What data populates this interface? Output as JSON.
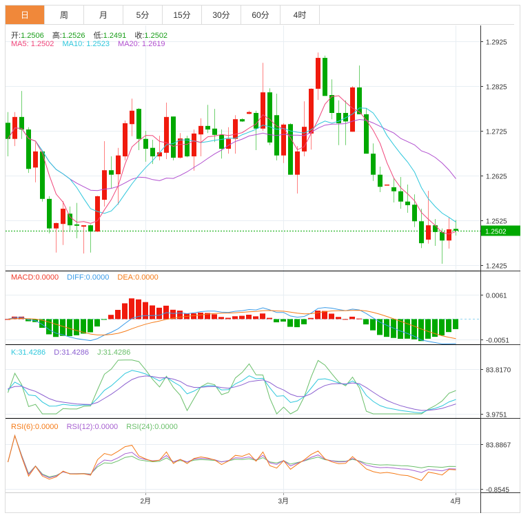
{
  "tabs": [
    "日",
    "周",
    "月",
    "5分",
    "15分",
    "30分",
    "60分",
    "4时"
  ],
  "active_tab": 0,
  "ohlc_legend": {
    "open_label": "开:",
    "open": "1.2506",
    "high_label": "高:",
    "high": "1.2526",
    "low_label": "低:",
    "low": "1.2491",
    "close_label": "收:",
    "close": "1.2502"
  },
  "ma_legend": {
    "ma5_label": "MA5:",
    "ma5": "1.2502",
    "ma10_label": "MA10:",
    "ma10": "1.2523",
    "ma20_label": "MA20:",
    "ma20": "1.2619"
  },
  "macd_legend": {
    "macd_label": "MACD:",
    "macd": "0.0000",
    "diff_label": "DIFF:",
    "diff": "0.0000",
    "dea_label": "DEA:",
    "dea": "0.0000"
  },
  "kdj_legend": {
    "k_label": "K:",
    "k": "31.4286",
    "d_label": "D:",
    "d": "31.4286",
    "j_label": "J:",
    "j": "31.4286"
  },
  "rsi_legend": {
    "rsi6_label": "RSI(6):",
    "rsi6": "0.0000",
    "rsi12_label": "RSI(12):",
    "rsi12": "0.0000",
    "rsi24_label": "RSI(24):",
    "rsi24": "0.0000"
  },
  "colors": {
    "accent": "#f0883a",
    "up": "#f01a0d",
    "down": "#00a800",
    "up_wick": "#ff7f7f",
    "down_wick": "#6fd06f",
    "ma5": "#f0457a",
    "ma10": "#2ec7dc",
    "ma20": "#b14fcf",
    "diff": "#3a9be8",
    "dea": "#f57a16",
    "k": "#2ec7dc",
    "d": "#8b5fd0",
    "j": "#6abf6a",
    "rsi6": "#f57a16",
    "rsi12": "#a65fd0",
    "rsi24": "#6abf6a"
  },
  "chart_data": {
    "type": "candlestick",
    "price_axis": {
      "ticks": [
        "1.2925",
        "1.2825",
        "1.2725",
        "1.2625",
        "1.2525",
        "1.2425"
      ],
      "range": [
        1.2425,
        1.2925
      ]
    },
    "last_price": "1.2502",
    "macd_axis": {
      "ticks": [
        "0.0061",
        "-0.0051"
      ],
      "range": [
        -0.0051,
        0.0061
      ]
    },
    "kdj_axis": {
      "ticks": [
        "83.8170",
        "3.9751"
      ],
      "range": [
        3.9751,
        83.817
      ]
    },
    "rsi_axis": {
      "ticks": [
        "83.8867",
        "-0.8545"
      ],
      "range": [
        -0.8545,
        83.8867
      ]
    },
    "x_labels": [
      {
        "index": 20,
        "label": "2月"
      },
      {
        "index": 40,
        "label": "3月"
      },
      {
        "index": 65,
        "label": "4月"
      }
    ],
    "ohlc": [
      [
        1.2743,
        1.2767,
        1.2668,
        1.2707
      ],
      [
        1.2707,
        1.2767,
        1.2691,
        1.2756
      ],
      [
        1.2756,
        1.2814,
        1.2707,
        1.2728
      ],
      [
        1.2728,
        1.2733,
        1.2631,
        1.264
      ],
      [
        1.2643,
        1.2699,
        1.261,
        1.2679
      ],
      [
        1.2679,
        1.2679,
        1.2567,
        1.2573
      ],
      [
        1.2573,
        1.2579,
        1.2496,
        1.2507
      ],
      [
        1.2507,
        1.252,
        1.2453,
        1.2519
      ],
      [
        1.2517,
        1.2568,
        1.247,
        1.2551
      ],
      [
        1.254,
        1.2556,
        1.2499,
        1.2514
      ],
      [
        1.2516,
        1.2564,
        1.2485,
        1.2513
      ],
      [
        1.2511,
        1.2514,
        1.2451,
        1.2514
      ],
      [
        1.2514,
        1.2516,
        1.2453,
        1.25
      ],
      [
        1.25,
        1.258,
        1.2499,
        1.2579
      ],
      [
        1.2571,
        1.2702,
        1.2556,
        1.2637
      ],
      [
        1.2637,
        1.2668,
        1.2597,
        1.2627
      ],
      [
        1.2628,
        1.2687,
        1.256,
        1.267
      ],
      [
        1.2668,
        1.2748,
        1.2659,
        1.2742
      ],
      [
        1.274,
        1.2797,
        1.2713,
        1.277
      ],
      [
        1.2774,
        1.2776,
        1.2682,
        1.2707
      ],
      [
        1.2707,
        1.2725,
        1.2656,
        1.2685
      ],
      [
        1.2687,
        1.2705,
        1.2651,
        1.2668
      ],
      [
        1.2668,
        1.2714,
        1.2659,
        1.2677
      ],
      [
        1.2676,
        1.2788,
        1.2662,
        1.2756
      ],
      [
        1.2757,
        1.2757,
        1.2659,
        1.2665
      ],
      [
        1.2665,
        1.272,
        1.2663,
        1.2708
      ],
      [
        1.2708,
        1.2714,
        1.2666,
        1.2668
      ],
      [
        1.2668,
        1.2728,
        1.2636,
        1.2719
      ],
      [
        1.2717,
        1.2753,
        1.2668,
        1.2736
      ],
      [
        1.2736,
        1.2783,
        1.272,
        1.2728
      ],
      [
        1.273,
        1.2774,
        1.27,
        1.2716
      ],
      [
        1.2716,
        1.2728,
        1.2663,
        1.2685
      ],
      [
        1.2685,
        1.2733,
        1.2674,
        1.2707
      ],
      [
        1.2707,
        1.276,
        1.2674,
        1.2751
      ],
      [
        1.2751,
        1.2753,
        1.2745,
        1.2746
      ],
      [
        1.2763,
        1.277,
        1.2762,
        1.2767
      ],
      [
        1.2765,
        1.277,
        1.2682,
        1.273
      ],
      [
        1.273,
        1.2877,
        1.2725,
        1.2811
      ],
      [
        1.2811,
        1.282,
        1.2693,
        1.2699
      ],
      [
        1.276,
        1.2808,
        1.2659,
        1.267
      ],
      [
        1.267,
        1.2742,
        1.2653,
        1.2739
      ],
      [
        1.274,
        1.2742,
        1.2627,
        1.2627
      ],
      [
        1.2627,
        1.2691,
        1.2585,
        1.2679
      ],
      [
        1.2679,
        1.2791,
        1.2668,
        1.2734
      ],
      [
        1.2719,
        1.282,
        1.2683,
        1.2819
      ],
      [
        1.2819,
        1.29,
        1.2794,
        1.2888
      ],
      [
        1.2888,
        1.2893,
        1.2803,
        1.2803
      ],
      [
        1.2805,
        1.284,
        1.2751,
        1.2765
      ],
      [
        1.2765,
        1.2793,
        1.2693,
        1.2742
      ],
      [
        1.2765,
        1.2793,
        1.2693,
        1.2746
      ],
      [
        1.2723,
        1.2825,
        1.2723,
        1.2822
      ],
      [
        1.2822,
        1.2871,
        1.2762,
        1.2762
      ],
      [
        1.2762,
        1.2776,
        1.2674,
        1.2674
      ],
      [
        1.2674,
        1.2697,
        1.2613,
        1.2627
      ],
      [
        1.2627,
        1.2645,
        1.2588,
        1.26
      ],
      [
        1.2603,
        1.2605,
        1.2603,
        1.2605
      ],
      [
        1.2599,
        1.262,
        1.2565,
        1.259
      ],
      [
        1.259,
        1.2622,
        1.2551,
        1.2567
      ],
      [
        1.2567,
        1.2605,
        1.2542,
        1.2559
      ],
      [
        1.256,
        1.2583,
        1.251,
        1.2523
      ],
      [
        1.2523,
        1.2551,
        1.2463,
        1.2474
      ],
      [
        1.2482,
        1.2591,
        1.2473,
        1.2514
      ],
      [
        1.2514,
        1.2528,
        1.2468,
        1.2499
      ],
      [
        1.2499,
        1.2507,
        1.2428,
        1.248
      ],
      [
        1.248,
        1.2531,
        1.2462,
        1.2505
      ],
      [
        1.2506,
        1.2526,
        1.2491,
        1.2502
      ]
    ]
  }
}
